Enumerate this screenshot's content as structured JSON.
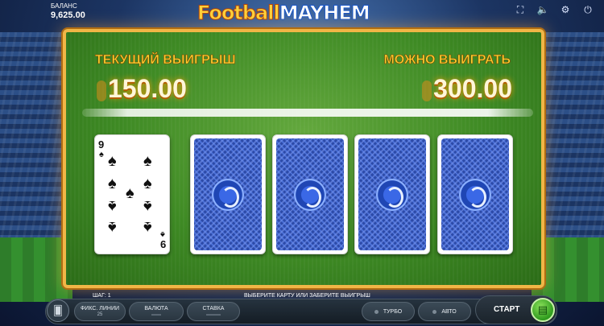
{
  "header": {
    "balance_label": "БАЛАНС",
    "balance_value": "9,625.00",
    "logo_word1": "Football",
    "logo_word2": "MAYHEM",
    "icons": [
      "fullscreen-icon",
      "volume-icon",
      "settings-icon",
      "power-icon"
    ]
  },
  "board": {
    "current_win_label": "ТЕКУЩИЙ ВЫИГРЫШ",
    "current_win_amount": "150.00",
    "possible_win_label": "МОЖНО ВЫИГРАТЬ",
    "possible_win_amount": "300.00",
    "dealer_card": {
      "rank": "9",
      "suit": "♠"
    },
    "hidden_cards": 4
  },
  "footer": {
    "step_label": "ШАГ: 1",
    "hint": "ВЫБЕРИТЕ КАРТУ ИЛИ ЗАБЕРИТЕ ВЫИГРЫШ",
    "lines_label": "ФИКС. ЛИНИИ",
    "lines_value": "25",
    "currency_label": "ВАЛЮТА",
    "bet_label": "СТАВКА",
    "turbo_label": "ТУРБО",
    "auto_label": "АВТО",
    "start_label": "СТАРТ"
  },
  "colors": {
    "gold": "#ffd32f",
    "felt": "#3e8a24",
    "card_back": "#2c4aa8",
    "frame": "#f1b646"
  }
}
